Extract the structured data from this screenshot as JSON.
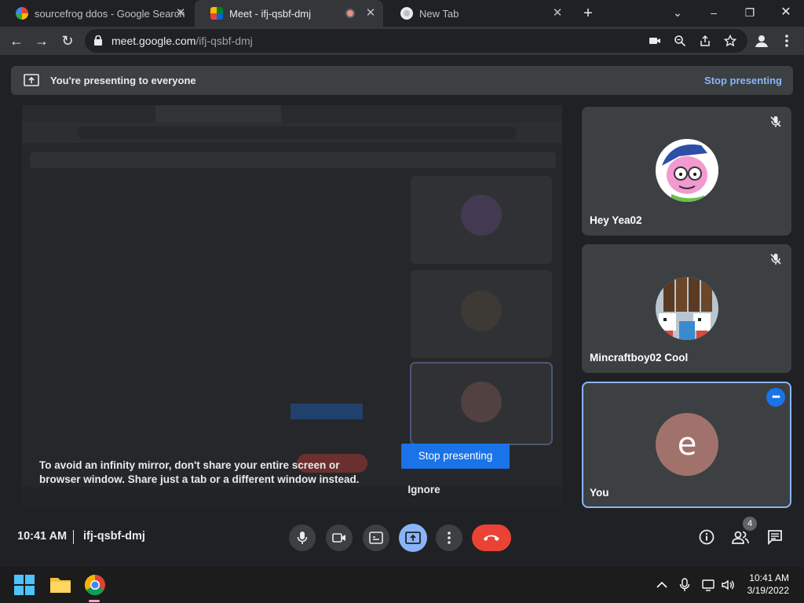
{
  "browser": {
    "tabs": [
      {
        "label": "sourcefrog ddos - Google Search",
        "icon": "google-icon",
        "active": false
      },
      {
        "label": "Meet - ifj-qsbf-dmj",
        "icon": "meet-icon",
        "active": true,
        "recording": true
      },
      {
        "label": "New Tab",
        "icon": "chrome-icon",
        "active": false
      }
    ],
    "new_tab_label": "+",
    "url_host": "meet.google.com",
    "url_path": "/ifj-qsbf-dmj"
  },
  "banner": {
    "text": "You're presenting to everyone",
    "stop_label": "Stop presenting"
  },
  "mirror_warning": {
    "text": "To avoid an infinity mirror, don't share your entire screen or browser window. Share just a tab or a different window instead.",
    "stop_label": "Stop presenting",
    "ignore_label": "Ignore"
  },
  "participants": [
    {
      "name": "Hey Yea02",
      "muted": true,
      "avatar": "cartoon-avatar"
    },
    {
      "name": "Mincraftboy02 Cool",
      "muted": true,
      "avatar": "minecraft-avatar"
    },
    {
      "name": "You",
      "letter": "e",
      "avatar_color": "#a1726b",
      "selected": true,
      "menu_label": "•••"
    }
  ],
  "meeting": {
    "time": "10:41 AM",
    "code": "ifj-qsbf-dmj",
    "people_count": "4"
  },
  "taskbar": {
    "time": "10:41 AM",
    "date": "3/19/2022"
  },
  "colors": {
    "accent": "#1a73e8",
    "link": "#8ab4f8",
    "leave": "#ea4335",
    "background": "#202124"
  }
}
